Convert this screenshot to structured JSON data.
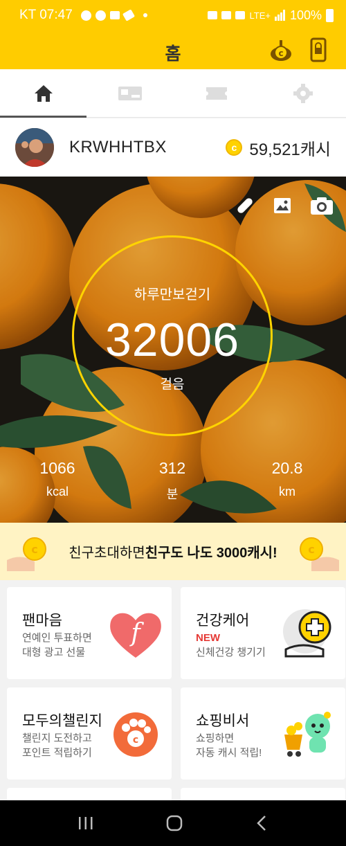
{
  "status_bar": {
    "carrier_time": "KT 07:47",
    "network": "LTE+",
    "battery": "100%"
  },
  "app_bar": {
    "title": "홈",
    "icons": [
      "cash-coin-icon",
      "lock-phone-icon"
    ]
  },
  "tabs": [
    {
      "name": "home",
      "icon": "home-icon",
      "active": true
    },
    {
      "name": "cash",
      "icon": "cash-icon",
      "active": false
    },
    {
      "name": "ticket",
      "icon": "ticket-icon",
      "active": false
    },
    {
      "name": "settings",
      "icon": "gear-icon",
      "active": false
    }
  ],
  "profile": {
    "username": "KRWHHTBX",
    "cash": "59,521캐시",
    "coin_symbol": "c"
  },
  "hero": {
    "tools": [
      "pill-icon",
      "image-icon",
      "camera-icon"
    ],
    "label": "하루만보걷기",
    "steps": "32006",
    "steps_unit": "걸음",
    "stats": [
      {
        "value": "1066",
        "unit": "kcal"
      },
      {
        "value": "312",
        "unit": "분"
      },
      {
        "value": "20.8",
        "unit": "km"
      }
    ]
  },
  "invite": {
    "text_normal": "친구초대하면 ",
    "text_bold": "친구도 나도 3000캐시!"
  },
  "cards": [
    {
      "title": "팬마음",
      "line1": "연예인 투표하면",
      "line2": "대형 광고 선물"
    },
    {
      "title": "건강케어",
      "line1": "NEW",
      "line2": "신체건강 챙기기"
    },
    {
      "title": "모두의챌린지",
      "line1": "챌린지 도전하고",
      "line2": "포인트 적립하기"
    },
    {
      "title": "쇼핑비서",
      "line1": "쇼핑하면",
      "line2": "자동 캐시 적립!"
    }
  ],
  "colors": {
    "brand_yellow": "#ffcc00",
    "ring_yellow": "#ffd400",
    "new_red": "#e53935",
    "invite_bg": "#fff3c4"
  }
}
